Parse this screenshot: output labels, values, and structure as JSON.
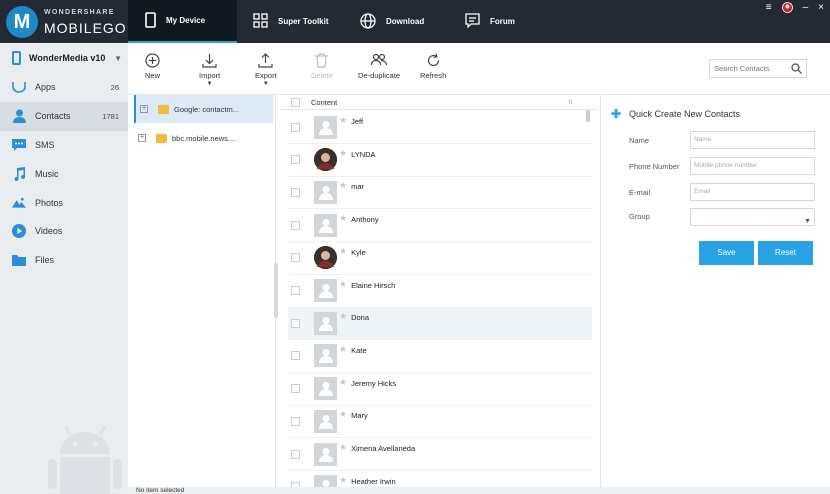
{
  "app": {
    "brand_top": "WONDERSHARE",
    "brand_main": "MOBILEGO",
    "logo_letter": "M"
  },
  "topnav": [
    {
      "label": "My Device",
      "icon": "phone-icon",
      "active": true
    },
    {
      "label": "Super Toolkit",
      "icon": "grid-icon",
      "active": false
    },
    {
      "label": "Download",
      "icon": "globe-icon",
      "active": false
    },
    {
      "label": "Forum",
      "icon": "forum-icon",
      "active": false
    }
  ],
  "window_controls": {
    "menu": "≡",
    "minimize": "–",
    "close": "×"
  },
  "sidebar": {
    "device_name": "WonderMedia v10",
    "items": [
      {
        "label": "Apps",
        "count": "26",
        "icon": "apps-icon"
      },
      {
        "label": "Contacts",
        "count": "1781",
        "icon": "contacts-icon",
        "active": true
      },
      {
        "label": "SMS",
        "count": "",
        "icon": "sms-icon"
      },
      {
        "label": "Music",
        "count": "",
        "icon": "music-icon"
      },
      {
        "label": "Photos",
        "count": "",
        "icon": "photos-icon"
      },
      {
        "label": "Videos",
        "count": "",
        "icon": "videos-icon"
      },
      {
        "label": "Files",
        "count": "",
        "icon": "files-icon"
      }
    ]
  },
  "toolbar": {
    "new": "New",
    "import": "Import",
    "export": "Export",
    "delete": "Delete",
    "deduplicate": "De-duplicate",
    "refresh": "Refresh",
    "search_placeholder": "Search Contacts"
  },
  "sources": [
    {
      "label": "Google: contactm...",
      "active": true
    },
    {
      "label": "bbc.mobile.news....",
      "active": false
    }
  ],
  "list": {
    "header": "Content",
    "contacts": [
      {
        "name": "Jeff",
        "photo": false
      },
      {
        "name": "LYNDA",
        "photo": true
      },
      {
        "name": "mar",
        "photo": false
      },
      {
        "name": "Anthony",
        "photo": false
      },
      {
        "name": "Kyle",
        "photo": true
      },
      {
        "name": "Elaine  Hirsch",
        "photo": false
      },
      {
        "name": "Dona",
        "photo": false,
        "selected": true
      },
      {
        "name": "Kate",
        "photo": false
      },
      {
        "name": "Jeremy  Hicks",
        "photo": false
      },
      {
        "name": "Mary",
        "photo": false
      },
      {
        "name": "Ximena  Avellaneda",
        "photo": false
      },
      {
        "name": "Heather  Irwin",
        "photo": false
      }
    ]
  },
  "quick_create": {
    "title": "Quick Create New Contacts",
    "name_label": "Name",
    "name_placeholder": "Name",
    "phone_label": "Phone Number",
    "phone_placeholder": "Mobile phone number",
    "email_label": "E-mail",
    "email_placeholder": "Email",
    "group_label": "Group",
    "group_value": "",
    "save": "Save",
    "reset": "Reset"
  },
  "status": "No item selected",
  "colors": {
    "accent": "#2aa3e6",
    "topbar": "#232a33",
    "sidebar": "#eaedf0"
  }
}
